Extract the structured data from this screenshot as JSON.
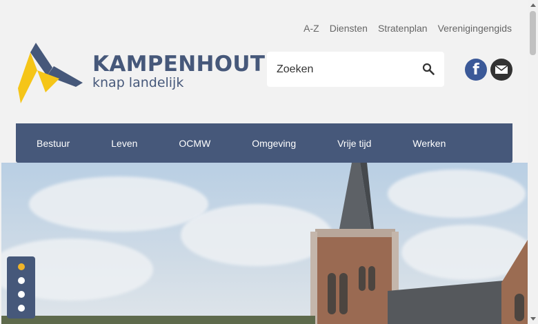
{
  "top_links": [
    "A-Z",
    "Diensten",
    "Stratenplan",
    "Verenigingengids"
  ],
  "logo": {
    "name": "KAMPENHOUT",
    "tagline": "knap landelijk"
  },
  "search": {
    "placeholder": "Zoeken"
  },
  "social": {
    "facebook_label": "f"
  },
  "nav": [
    "Bestuur",
    "Leven",
    "OCMW",
    "Omgeving",
    "Vrije tijd",
    "Werken"
  ],
  "slider": {
    "count": 4,
    "active": 0
  },
  "colors": {
    "brand": "#46587a",
    "accent": "#f0b429",
    "facebook": "#3b5998"
  }
}
